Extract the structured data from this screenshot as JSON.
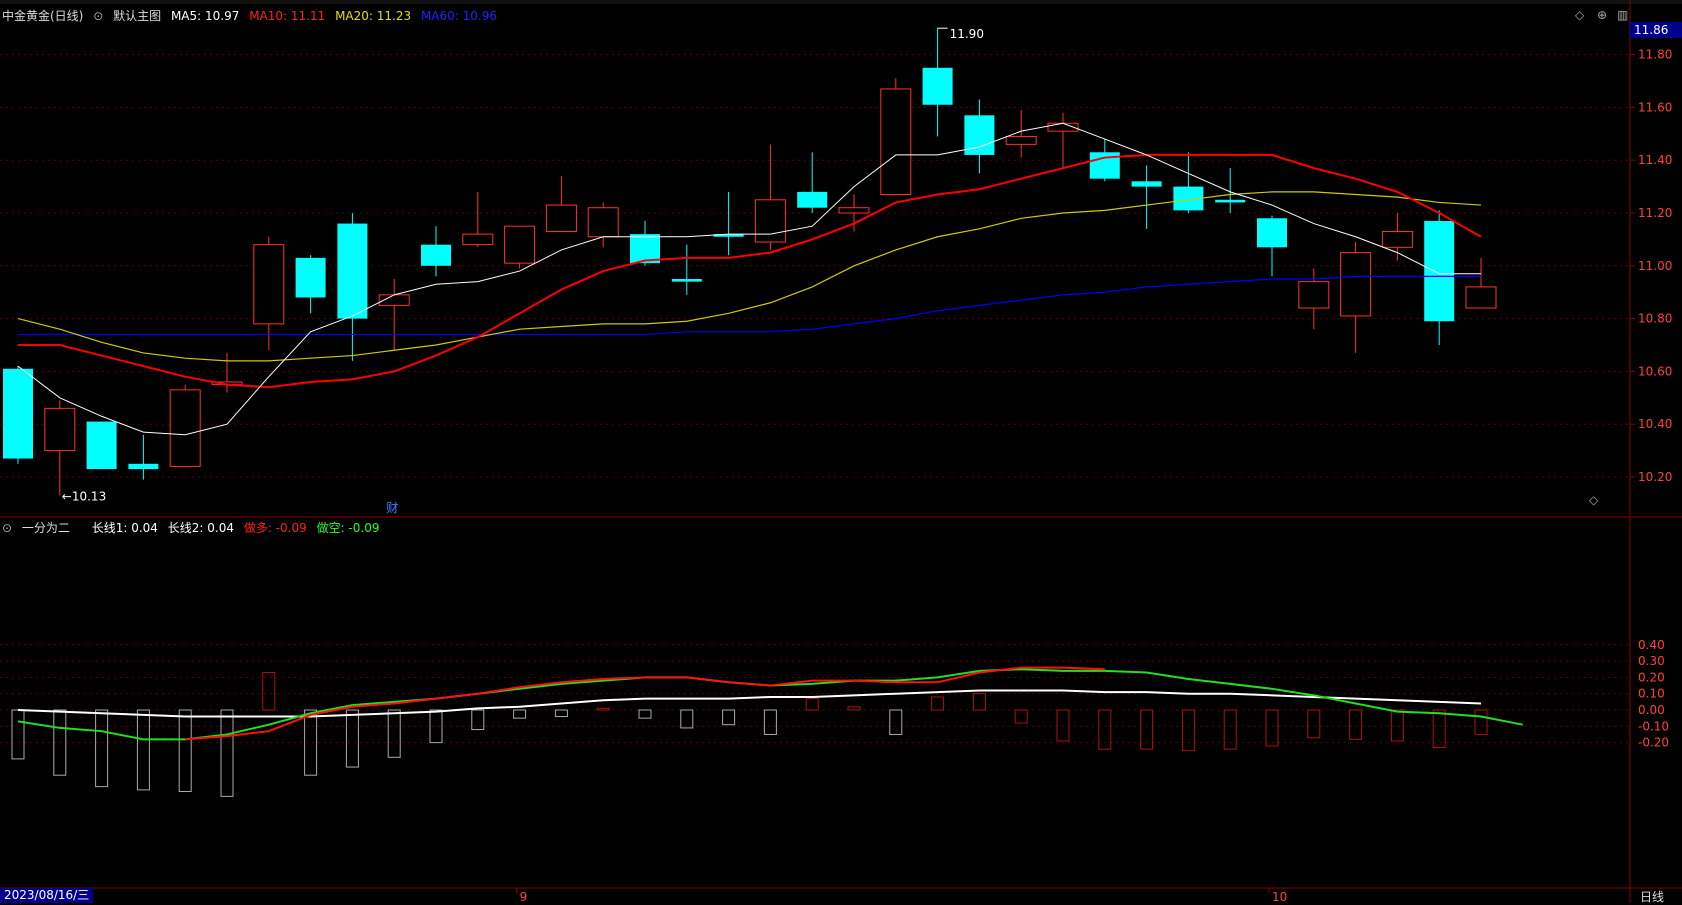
{
  "header": {
    "stock_name": "中金黄金(日线)",
    "main_chart_label": "默认主图",
    "ma5": "MA5: 10.97",
    "ma10": "MA10: 11.11",
    "ma20": "MA20: 11.23",
    "ma60": "MA60: 10.96"
  },
  "indicator_header": {
    "name": "一分为二",
    "l1": "长线1: 0.04",
    "l2": "长线2: 0.04",
    "long": "做多: -0.09",
    "short": "做空: -0.09"
  },
  "price_axis": {
    "current": "11.86",
    "labels": [
      "11.80",
      "11.60",
      "11.40",
      "11.20",
      "11.00",
      "10.80",
      "10.60",
      "10.40",
      "10.20"
    ],
    "values": [
      11.8,
      11.6,
      11.4,
      11.2,
      11.0,
      10.8,
      10.6,
      10.4,
      10.2
    ]
  },
  "ind_axis": {
    "labels": [
      "0.40",
      "0.30",
      "0.20",
      "0.10",
      "0.00",
      "-0.10",
      "-0.20"
    ],
    "values": [
      0.4,
      0.3,
      0.2,
      0.1,
      0.0,
      -0.1,
      -0.2
    ]
  },
  "annotations": {
    "high": "11.90",
    "low": "10.13",
    "fin_marker": "财"
  },
  "bottom": {
    "date": "2023/08/16/三",
    "month9": "9",
    "month10": "10",
    "period": "日线"
  },
  "colors": {
    "up": "#ff3030",
    "down": "#00ffff",
    "ma5": "#ffffff",
    "ma10": "#ff0000",
    "ma20": "#cccc00",
    "ma60": "#0000ff"
  },
  "chart_data": {
    "type": "candlestick",
    "candles": [
      [
        10.61,
        10.27,
        10.62,
        10.25
      ],
      [
        10.3,
        10.46,
        10.49,
        10.13
      ],
      [
        10.41,
        10.23,
        10.41,
        10.23
      ],
      [
        10.25,
        10.23,
        10.36,
        10.19
      ],
      [
        10.24,
        10.53,
        10.55,
        10.24
      ],
      [
        10.55,
        10.56,
        10.67,
        10.52
      ],
      [
        10.78,
        11.08,
        11.11,
        10.68
      ],
      [
        11.03,
        10.88,
        11.04,
        10.82
      ],
      [
        11.16,
        10.8,
        11.2,
        10.64
      ],
      [
        10.85,
        10.89,
        10.95,
        10.68
      ],
      [
        11.08,
        11.0,
        11.15,
        10.96
      ],
      [
        11.08,
        11.12,
        11.28,
        11.07
      ],
      [
        11.01,
        11.15,
        11.15,
        10.99
      ],
      [
        11.13,
        11.23,
        11.34,
        11.13
      ],
      [
        11.11,
        11.22,
        11.24,
        11.07
      ],
      [
        11.12,
        11.01,
        11.17,
        11.0
      ],
      [
        10.95,
        10.94,
        11.08,
        10.89
      ],
      [
        11.12,
        11.11,
        11.28,
        11.04
      ],
      [
        11.09,
        11.25,
        11.46,
        11.06
      ],
      [
        11.28,
        11.22,
        11.43,
        11.2
      ],
      [
        11.2,
        11.22,
        11.27,
        11.13
      ],
      [
        11.27,
        11.67,
        11.71,
        11.27
      ],
      [
        11.75,
        11.61,
        11.9,
        11.49
      ],
      [
        11.57,
        11.42,
        11.63,
        11.35
      ],
      [
        11.46,
        11.49,
        11.59,
        11.41
      ],
      [
        11.51,
        11.54,
        11.58,
        11.37
      ],
      [
        11.43,
        11.33,
        11.48,
        11.32
      ],
      [
        11.32,
        11.3,
        11.38,
        11.14
      ],
      [
        11.3,
        11.21,
        11.43,
        11.2
      ],
      [
        11.25,
        11.24,
        11.37,
        11.2
      ],
      [
        11.18,
        11.07,
        11.19,
        10.96
      ],
      [
        10.84,
        10.94,
        10.99,
        10.76
      ],
      [
        10.81,
        11.05,
        11.09,
        10.67
      ],
      [
        11.07,
        11.13,
        11.2,
        11.02
      ],
      [
        11.17,
        10.79,
        11.21,
        10.7
      ],
      [
        10.84,
        10.92,
        11.03,
        10.84
      ]
    ],
    "ma5": [
      10.62,
      10.5,
      10.43,
      10.37,
      10.36,
      10.4,
      10.58,
      10.75,
      10.81,
      10.89,
      10.93,
      10.94,
      10.98,
      11.06,
      11.11,
      11.11,
      11.11,
      11.12,
      11.12,
      11.15,
      11.3,
      11.42,
      11.42,
      11.45,
      11.51,
      11.54,
      11.48,
      11.42,
      11.35,
      11.28,
      11.23,
      11.16,
      11.11,
      11.05,
      10.97,
      10.97
    ],
    "ma10": [
      10.7,
      10.7,
      10.66,
      10.62,
      10.58,
      10.55,
      10.54,
      10.56,
      10.57,
      10.6,
      10.66,
      10.73,
      10.82,
      10.91,
      10.98,
      11.02,
      11.03,
      11.03,
      11.05,
      11.1,
      11.16,
      11.24,
      11.27,
      11.29,
      11.33,
      11.37,
      11.41,
      11.42,
      11.42,
      11.42,
      11.42,
      11.37,
      11.33,
      11.28,
      11.2,
      11.11
    ],
    "ma20": [
      10.8,
      10.76,
      10.71,
      10.67,
      10.65,
      10.64,
      10.64,
      10.65,
      10.66,
      10.68,
      10.7,
      10.73,
      10.76,
      10.77,
      10.78,
      10.78,
      10.79,
      10.82,
      10.86,
      10.92,
      11.0,
      11.06,
      11.11,
      11.14,
      11.18,
      11.2,
      11.21,
      11.23,
      11.25,
      11.27,
      11.28,
      11.28,
      11.27,
      11.26,
      11.24,
      11.23
    ],
    "ma60": [
      10.74,
      10.74,
      10.74,
      10.74,
      10.74,
      10.74,
      10.74,
      10.74,
      10.74,
      10.74,
      10.74,
      10.74,
      10.74,
      10.74,
      10.74,
      10.74,
      10.75,
      10.75,
      10.75,
      10.76,
      10.78,
      10.8,
      10.83,
      10.85,
      10.87,
      10.89,
      10.9,
      10.92,
      10.93,
      10.94,
      10.95,
      10.95,
      10.96,
      10.96,
      10.96,
      10.96
    ],
    "ind_hist": [
      -0.3,
      -0.4,
      -0.47,
      -0.49,
      -0.5,
      -0.53,
      0.23,
      -0.4,
      -0.35,
      -0.29,
      -0.2,
      -0.12,
      -0.05,
      -0.04,
      0.01,
      -0.05,
      -0.11,
      -0.09,
      -0.15,
      0.07,
      0.02,
      -0.15,
      0.08,
      0.1,
      -0.08,
      -0.19,
      -0.24,
      -0.24,
      -0.25,
      -0.24,
      -0.22,
      -0.17,
      -0.18,
      -0.19,
      -0.23,
      -0.15,
      -0.12
    ],
    "ind_up": [
      0.0,
      0.0,
      0.0,
      0.0,
      -0.04,
      -0.03,
      0.13,
      -0.01,
      0.12,
      0.02,
      0.03,
      0.04,
      0.05,
      0.06,
      0.07,
      -0.05,
      -0.05,
      0.14,
      -0.04,
      0.14,
      0.18,
      0.11,
      0.08,
      0.05,
      0.02,
      0.0
    ],
    "ind_white": [
      0.0,
      -0.01,
      -0.02,
      -0.03,
      -0.04,
      -0.04,
      -0.04,
      -0.04,
      -0.03,
      -0.02,
      -0.01,
      0.01,
      0.02,
      0.04,
      0.06,
      0.07,
      0.07,
      0.07,
      0.08,
      0.08,
      0.09,
      0.1,
      0.11,
      0.12,
      0.12,
      0.12,
      0.11,
      0.11,
      0.1,
      0.1,
      0.09,
      0.08,
      0.07,
      0.06,
      0.05,
      0.04
    ],
    "ind_green": [
      -0.07,
      -0.11,
      -0.13,
      -0.18,
      -0.18,
      -0.15,
      -0.09,
      -0.02,
      0.03,
      0.05,
      0.07,
      0.1,
      0.13,
      0.16,
      0.18,
      0.2,
      0.2,
      0.17,
      0.15,
      0.16,
      0.18,
      0.18,
      0.2,
      0.24,
      0.25,
      0.24,
      0.24,
      0.23,
      0.19,
      0.16,
      0.13,
      0.09,
      0.04,
      -0.01,
      -0.02,
      -0.04,
      -0.09
    ],
    "ind_red": [
      -0.18,
      -0.16,
      -0.13,
      -0.03,
      0.02,
      0.04,
      0.07,
      0.1,
      0.14,
      0.17,
      0.19,
      0.2,
      0.2,
      0.17,
      0.15,
      0.18,
      0.18,
      0.17,
      0.17,
      0.23,
      0.26,
      0.26,
      0.25
    ]
  }
}
